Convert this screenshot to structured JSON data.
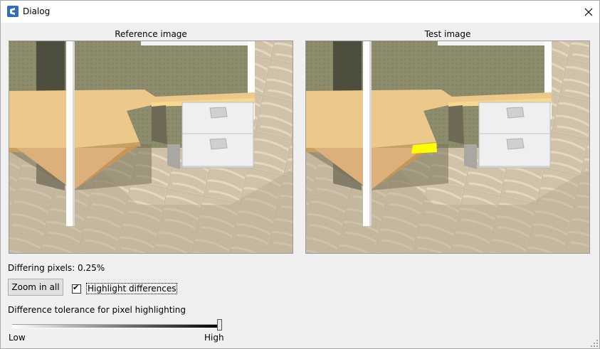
{
  "window": {
    "title": "Dialog"
  },
  "icons": {
    "app": "app-logo-icon",
    "close": "close-icon"
  },
  "reference": {
    "label": "Reference image"
  },
  "test": {
    "label": "Test image",
    "highlight_color": "#ffff00"
  },
  "stats": {
    "differing_pixels": "Differing pixels: 0.25%"
  },
  "controls": {
    "zoom_button": "Zoom in all",
    "highlight_checkbox": {
      "label": "Highlight differences",
      "checked": true
    },
    "tolerance": {
      "label": "Difference tolerance for pixel highlighting",
      "low": "Low",
      "high": "High",
      "value": 1.0
    }
  }
}
